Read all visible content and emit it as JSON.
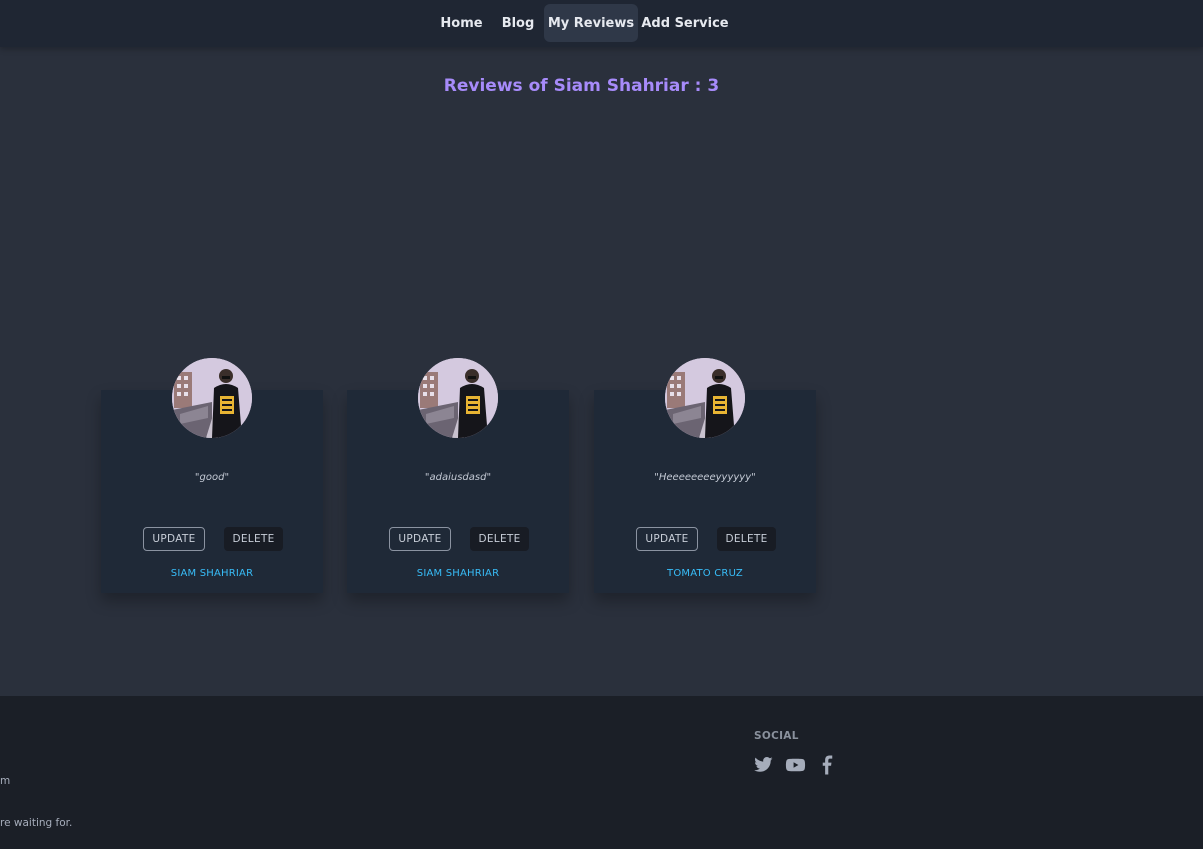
{
  "nav": {
    "items": [
      {
        "label": "Home",
        "active": false
      },
      {
        "label": "Blog",
        "active": false
      },
      {
        "label": "My Reviews",
        "active": true
      },
      {
        "label": "Add Service",
        "active": false
      }
    ]
  },
  "page": {
    "title": "Reviews of Siam Shahriar : 3"
  },
  "reviews": [
    {
      "text": "\"good\"",
      "update_label": "UPDATE",
      "delete_label": "DELETE",
      "name": "SIAM SHAHRIAR"
    },
    {
      "text": "\"adaiusdasd\"",
      "update_label": "UPDATE",
      "delete_label": "DELETE",
      "name": "SIAM SHAHRIAR"
    },
    {
      "text": "\"Heeeeeeeeyyyyyy\"",
      "update_label": "UPDATE",
      "delete_label": "DELETE",
      "name": "TOMATO CRUZ"
    }
  ],
  "footer": {
    "line1": "m",
    "line2": "re waiting for.",
    "social_title": "SOCIAL",
    "social_icons": [
      "twitter-icon",
      "youtube-icon",
      "facebook-icon"
    ]
  },
  "colors": {
    "accent_title": "#a78bfa",
    "reviewer_name": "#38bdf8",
    "background": "#2a303c",
    "card": "#1f2937"
  }
}
